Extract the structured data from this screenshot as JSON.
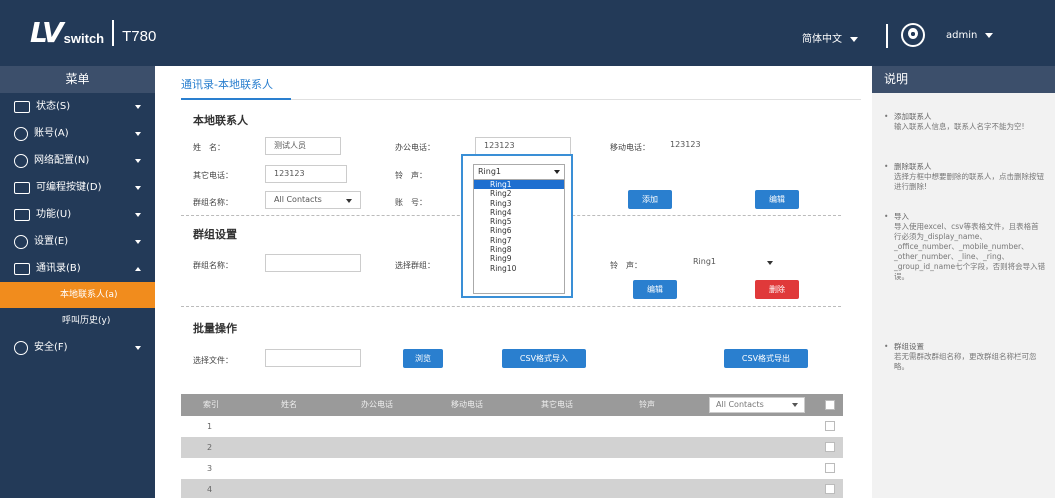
{
  "header": {
    "logo_lv": "LV",
    "logo_switch": "switch",
    "model": "T780",
    "language": "简体中文",
    "user": "admin"
  },
  "sidebar": {
    "title": "菜单",
    "items": [
      {
        "label": "状态(S)",
        "icon": "status-icon"
      },
      {
        "label": "账号(A)",
        "icon": "account-icon"
      },
      {
        "label": "网络配置(N)",
        "icon": "network-icon"
      },
      {
        "label": "可编程按键(D)",
        "icon": "keyboard-icon"
      },
      {
        "label": "功能(U)",
        "icon": "features-icon"
      },
      {
        "label": "设置(E)",
        "icon": "gear-icon"
      },
      {
        "label": "通讯录(B)",
        "icon": "phonebook-icon"
      }
    ],
    "subitems": [
      {
        "label": "本地联系人(a)",
        "active": true
      },
      {
        "label": "呼叫历史(y)",
        "active": false
      }
    ],
    "security": {
      "label": "安全(F)",
      "icon": "security-icon"
    }
  },
  "breadcrumb": "通讯录-本地联系人",
  "local_contacts": {
    "title": "本地联系人",
    "name_label": "姓　名：",
    "name_value": "测试人员",
    "office_label": "办公电话：",
    "office_value": "123123",
    "mobile_label": "移动电话：",
    "mobile_value": "123123",
    "other_label": "其它电话：",
    "other_value": "123123",
    "ring_label": "铃　声：",
    "group_label": "群组名称：",
    "group_value": "All Contacts",
    "account_label": "账　号：",
    "add_button": "添加",
    "edit_button": "编辑"
  },
  "ring_dropdown": {
    "selected": "Ring1",
    "options": [
      "Ring1",
      "Ring2",
      "Ring3",
      "Ring4",
      "Ring5",
      "Ring6",
      "Ring7",
      "Ring8",
      "Ring9",
      "Ring10"
    ]
  },
  "group_settings": {
    "title": "群组设置",
    "group_name_label": "群组名称：",
    "select_group_label": "选择群组：",
    "ring_label": "铃　声：",
    "ring_value": "Ring1",
    "edit_button": "编辑",
    "delete_button": "删除"
  },
  "batch": {
    "title": "批量操作",
    "select_file_label": "选择文件：",
    "browse_button": "浏览",
    "import_button": "CSV格式导入",
    "export_button": "CSV格式导出"
  },
  "table": {
    "headers": [
      "索引",
      "姓名",
      "办公电话",
      "移动电话",
      "其它电话",
      "铃声"
    ],
    "filter": "All Contacts",
    "rows": [
      "1",
      "2",
      "3",
      "4"
    ]
  },
  "help": {
    "title": "说明",
    "items": [
      {
        "head": "添加联系人",
        "body": "输入联系人信息，联系人名字不能为空!"
      },
      {
        "head": "删除联系人",
        "body": "选择方框中想要删除的联系人，点击删除按钮进行删除!"
      },
      {
        "head": "导入",
        "body": "导入使用excel、csv等表格文件，且表格首行必须为_display_name、_office_number、_mobile_number、_other_number、_line、_ring、_group_id_name七个字段，否则将会导入错误。"
      },
      {
        "head": "群组设置",
        "body": "若无需群改群组名称，更改群组名称栏可忽略。"
      }
    ]
  }
}
